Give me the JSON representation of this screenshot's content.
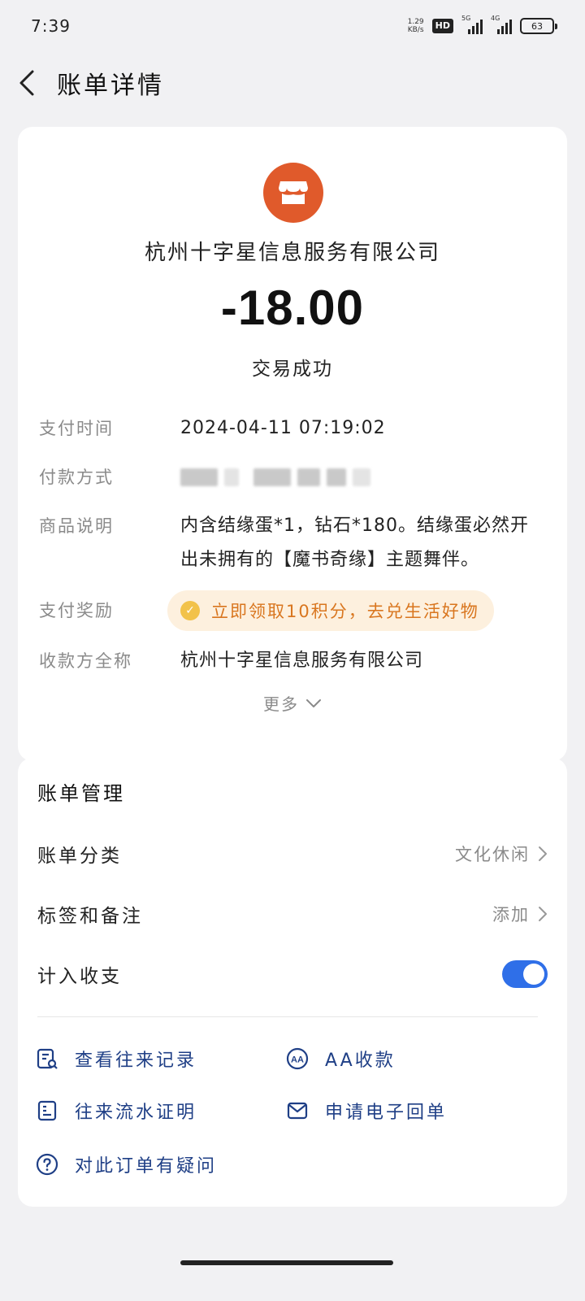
{
  "status_bar": {
    "time": "7:39",
    "net_speed_value": "1.29",
    "net_speed_unit": "KB/s",
    "hd_label": "HD",
    "signal1_label": "5G",
    "signal2_label": "4G",
    "battery": "63"
  },
  "header": {
    "title": "账单详情",
    "back_icon": "chevron-left-icon"
  },
  "transaction": {
    "merchant_icon": "store-icon",
    "merchant_icon_color": "#e05a2b",
    "merchant_name": "杭州十字星信息服务有限公司",
    "amount": "-18.00",
    "status": "交易成功"
  },
  "details": {
    "pay_time_label": "支付时间",
    "pay_time": "2024-04-11 07:19:02",
    "pay_method_label": "付款方式",
    "description_label": "商品说明",
    "description_line1": "内含结缘蛋*1，钻石*180。结缘蛋必然开",
    "description_line2": "出未拥有的【魔书奇缘】主题舞伴。",
    "reward_label": "支付奖励",
    "reward_text": "立即领取10积分，去兑生活好物",
    "reward_color": "#d9761f",
    "payee_label": "收款方全称",
    "payee": "杭州十字星信息服务有限公司",
    "more_label": "更多"
  },
  "management": {
    "title": "账单管理",
    "category_label": "账单分类",
    "category_value": "文化休闲",
    "tags_label": "标签和备注",
    "tags_value": "添加",
    "include_label": "计入收支",
    "include_enabled": true,
    "accent_color": "#2f6fe8"
  },
  "actions": {
    "history": "查看往来记录",
    "aa": "AA收款",
    "flow_proof": "往来流水证明",
    "receipt": "申请电子回单",
    "question": "对此订单有疑问"
  }
}
